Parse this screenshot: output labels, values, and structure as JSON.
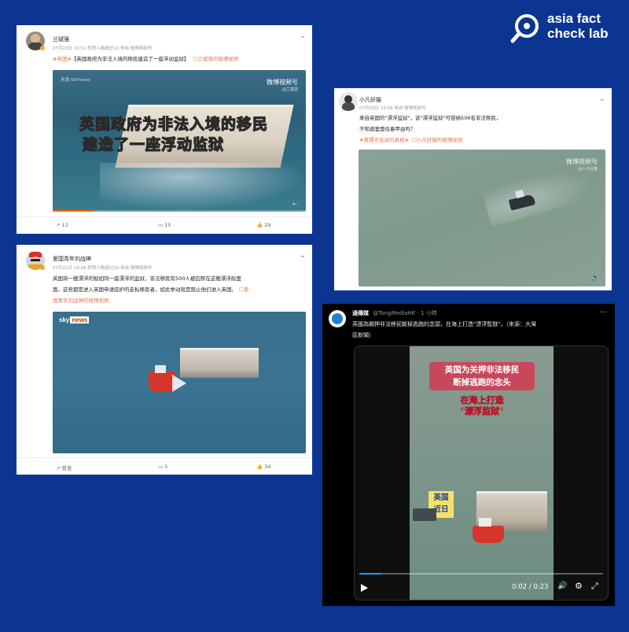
{
  "brand": {
    "logo_line1": "asia fact",
    "logo_line2": "check lab",
    "color": "#ffffff"
  },
  "card1": {
    "user": "兰斌强",
    "meta": "07月23日 10:51 转赞人数超过10  来自 微博视频号",
    "text_tag": "#英国#",
    "text": "【英国政府为非法入境的移民建造了一座浮动监狱】",
    "text_link": "☐兰斌强的微博视频",
    "video_source": "来源:SKYnews",
    "video_badge": "微博视频号",
    "video_badge_sub": "@兰斌强",
    "caption_line1": "英国政府为非法入境的移民",
    "caption_line2": "建造了一座浮动监狱",
    "share_count": "12",
    "comment_count": "15",
    "like_count": "29"
  },
  "card2": {
    "user": "小凡好猫",
    "meta": "07月20日 23:08  来自 微博视频号",
    "text_line1": "来自英国的\"漂浮监狱\"，该\"漂浮监狱\"可容纳506名非法移民，",
    "text_line2": "不知道里面住着甲由吗？",
    "text_tag1": "#黄镖不会说的真相#",
    "text_link": "☐小凡好猫的微博视频",
    "video_badge": "微博视频号",
    "video_badge_sub": "@小凡好猫"
  },
  "card3": {
    "user": "爱国青年刘战神",
    "meta": "07月21日 18:48 转赞人数超过20  来自 微博视频号",
    "text_line1": "英国将一艘漂浮的船如同一座漂浮的监狱，非法移民有500人被囚禁在这艘漂浮船里",
    "text_line2": "面，这些都是进入英国申请庇护的走私移民者，如此举动就是阻止他们进入英国。",
    "text_link1": "☐爱",
    "text_link2": "国青年刘战神的微博视频",
    "video_logo_sky": "sky",
    "video_logo_news": "news",
    "share_label": "转发",
    "comment_count": "5",
    "like_count": "34"
  },
  "tweet": {
    "name": "通傳媒",
    "handle": "@TongMediaHK · 1 小時",
    "text_line1": "英國為關押非法移民斷掉逃跑的念頭，在海上打造\"漂浮監獄\"。（來源：大灣",
    "text_line2": "區新聞）",
    "caption_red_line1": "英国为关押非法移民",
    "caption_red_line2": "断掉逃跑的念头",
    "caption_orange_line1": "在海上打造",
    "caption_orange_line2": "\"漂浮监狱\"",
    "label_line1": "英国",
    "label_line2": "近日",
    "time": "0:02 / 0:23",
    "progress": 0.087
  }
}
